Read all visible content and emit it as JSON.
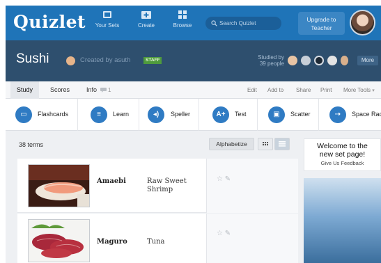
{
  "header": {
    "logo": "Quizlet",
    "nav": [
      {
        "label": "Your Sets",
        "icon": "sets-icon"
      },
      {
        "label": "Create",
        "icon": "create-icon"
      },
      {
        "label": "Browse",
        "icon": "browse-icon"
      }
    ],
    "search_placeholder": "Search Quizlet",
    "upgrade_line1": "Upgrade to",
    "upgrade_line2": "Teacher"
  },
  "set": {
    "title": "Sushi",
    "created_by": "Created by asuth",
    "badge": "STAFF",
    "studied_line1": "Studied by",
    "studied_line2": "39 people",
    "more_label": "More"
  },
  "tabs": [
    {
      "label": "Study",
      "active": true
    },
    {
      "label": "Scores",
      "active": false
    },
    {
      "label": "Info",
      "count": "1",
      "active": false
    }
  ],
  "actions": [
    "Edit",
    "Add to",
    "Share",
    "Print",
    "More Tools"
  ],
  "modes": [
    {
      "label": "Flashcards",
      "icon": "flashcards-icon",
      "glyph": "▭"
    },
    {
      "label": "Learn",
      "icon": "learn-icon",
      "glyph": "≡"
    },
    {
      "label": "Speller",
      "icon": "speaker-icon",
      "glyph": "◂)"
    },
    {
      "label": "Test",
      "icon": "test-icon",
      "glyph": "A+"
    },
    {
      "label": "Scatter",
      "icon": "scatter-icon",
      "glyph": "▣"
    },
    {
      "label": "Space Race",
      "icon": "space-race-icon",
      "glyph": "⇢"
    }
  ],
  "list": {
    "count_label": "38 terms",
    "alphabetize_label": "Alphabetize"
  },
  "welcome": {
    "line1": "Welcome to the",
    "line2": "new set page!",
    "feedback": "Give Us Feedback"
  },
  "terms": [
    {
      "term": "Amaebi",
      "definition": "Raw Sweet Shrimp",
      "image": "shrimp sushi"
    },
    {
      "term": "Maguro",
      "definition": "Tuna",
      "image": "tuna sashimi"
    }
  ]
}
